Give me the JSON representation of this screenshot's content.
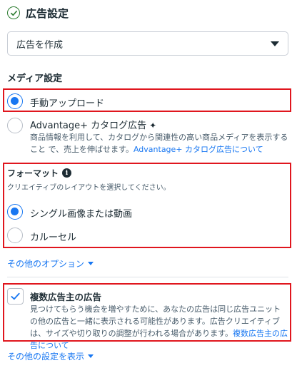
{
  "header": {
    "title": "広告設定",
    "icon": "check-circle-icon"
  },
  "ad_select": {
    "value": "広告を作成"
  },
  "media_settings": {
    "label": "メディア設定",
    "options": [
      {
        "label": "手動アップロード",
        "selected": true
      },
      {
        "label": "Advantage+ カタログ広告",
        "selected": false,
        "description": "商品情報を利用して、カタログから関連性の高い商品メディアを表示すること で、売上を伸ばせます。",
        "link": "Advantage+ カタログ広告について"
      }
    ]
  },
  "format": {
    "title": "フォーマット",
    "subtitle": "クリエイティブのレイアウトを選択してください。",
    "options": [
      {
        "label": "シングル画像または動画",
        "selected": true
      },
      {
        "label": "カルーセル",
        "selected": false
      }
    ]
  },
  "more_options": {
    "label": "その他のオプション"
  },
  "multi_advertiser": {
    "checked": true,
    "title": "複数広告主の広告",
    "description": "見つけてもらう機会を増やすために、あなたの広告は同じ広告ユニットの他の広告と一緒に表示される可能性があります。広告クリエイティブは、サイズや切り取りの調整が行われる場合があります。",
    "link": "複数広告主の広告について"
  },
  "more_settings": {
    "label": "その他の設定を表示"
  },
  "colors": {
    "accent": "#1877f2",
    "highlight": "#e0161e",
    "success": "#2e7d32"
  }
}
